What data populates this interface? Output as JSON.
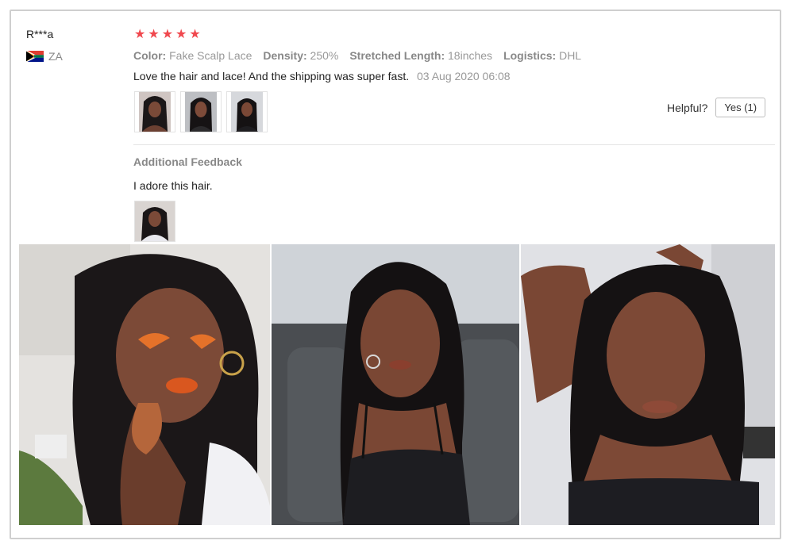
{
  "reviewer": {
    "name": "R***a",
    "country_code": "ZA",
    "flag_icon": "south-africa-flag-icon"
  },
  "rating": {
    "stars": 5,
    "max": 5,
    "star_color": "#f0484e"
  },
  "attributes": [
    {
      "key": "Color:",
      "value": "Fake Scalp Lace"
    },
    {
      "key": "Density:",
      "value": "250%"
    },
    {
      "key": "Stretched Length:",
      "value": "18inches"
    },
    {
      "key": "Logistics:",
      "value": "DHL"
    }
  ],
  "review": {
    "text": "Love the hair and lace! And the shipping was super fast.",
    "date": "03 Aug 2020 06:08"
  },
  "helpful": {
    "label": "Helpful?",
    "yes_label": "Yes (1)"
  },
  "additional": {
    "title": "Additional Feedback",
    "text": "I adore this hair."
  }
}
